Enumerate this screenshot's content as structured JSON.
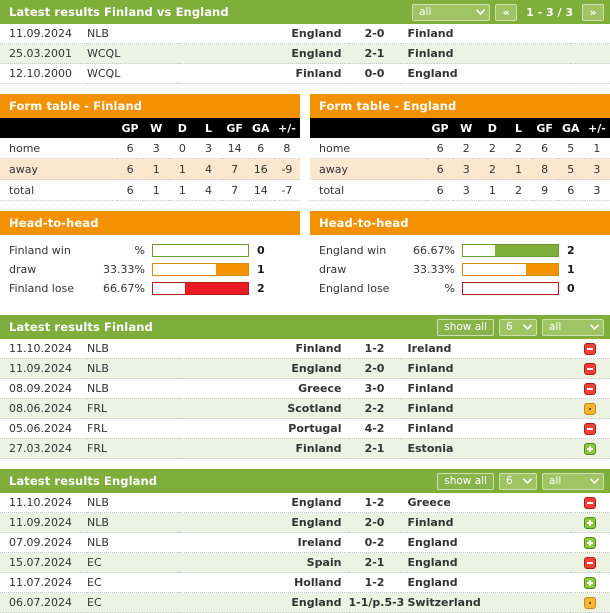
{
  "h2h_results": {
    "header": {
      "title": "Latest results Finland vs England",
      "filter_value": "all",
      "prev_label": "«",
      "next_label": "»",
      "page_label": "1 - 3 / 3"
    },
    "rows": [
      {
        "date": "11.09.2024",
        "comp": "NLB",
        "home": "England",
        "score": "2-0",
        "away": "Finland"
      },
      {
        "date": "25.03.2001",
        "comp": "WCQL",
        "home": "England",
        "score": "2-1",
        "away": "Finland"
      },
      {
        "date": "12.10.2000",
        "comp": "WCQL",
        "home": "Finland",
        "score": "0-0",
        "away": "England"
      }
    ]
  },
  "form_tables": [
    {
      "title": "Form table - Finland",
      "columns": [
        "",
        "GP",
        "W",
        "D",
        "L",
        "GF",
        "GA",
        "+/-"
      ],
      "rows": [
        {
          "label": "home",
          "gp": "6",
          "w": "3",
          "d": "0",
          "l": "3",
          "gf": "14",
          "ga": "6",
          "gd": "8"
        },
        {
          "label": "away",
          "gp": "6",
          "w": "1",
          "d": "1",
          "l": "4",
          "gf": "7",
          "ga": "16",
          "gd": "-9"
        },
        {
          "label": "total",
          "gp": "6",
          "w": "1",
          "d": "1",
          "l": "4",
          "gf": "7",
          "ga": "14",
          "gd": "-7"
        }
      ]
    },
    {
      "title": "Form table - England",
      "columns": [
        "",
        "GP",
        "W",
        "D",
        "L",
        "GF",
        "GA",
        "+/-"
      ],
      "rows": [
        {
          "label": "home",
          "gp": "6",
          "w": "2",
          "d": "2",
          "l": "2",
          "gf": "6",
          "ga": "5",
          "gd": "1"
        },
        {
          "label": "away",
          "gp": "6",
          "w": "3",
          "d": "2",
          "l": "1",
          "gf": "8",
          "ga": "5",
          "gd": "3"
        },
        {
          "label": "total",
          "gp": "6",
          "w": "3",
          "d": "1",
          "l": "2",
          "gf": "9",
          "ga": "6",
          "gd": "3"
        }
      ]
    }
  ],
  "head_to_head": [
    {
      "title": "Head-to-head",
      "rows": [
        {
          "label": "Finland win",
          "pct": "%",
          "fill": 0,
          "count": "0",
          "kind": "win"
        },
        {
          "label": "draw",
          "pct": "33.33%",
          "fill": 33.33,
          "count": "1",
          "kind": "draw"
        },
        {
          "label": "Finland lose",
          "pct": "66.67%",
          "fill": 66.67,
          "count": "2",
          "kind": "lose"
        }
      ]
    },
    {
      "title": "Head-to-head",
      "rows": [
        {
          "label": "England win",
          "pct": "66.67%",
          "fill": 66.67,
          "count": "2",
          "kind": "win"
        },
        {
          "label": "draw",
          "pct": "33.33%",
          "fill": 33.33,
          "count": "1",
          "kind": "draw"
        },
        {
          "label": "England lose",
          "pct": "%",
          "fill": 0,
          "count": "0",
          "kind": "lose"
        }
      ]
    }
  ],
  "latest_finland": {
    "header": {
      "title": "Latest results Finland",
      "show_all_label": "show all",
      "count_value": "6",
      "filter_value": "all"
    },
    "rows": [
      {
        "date": "11.10.2024",
        "comp": "NLB",
        "home": "Finland",
        "score": "1-2",
        "away": "Ireland",
        "status": "loss"
      },
      {
        "date": "11.09.2024",
        "comp": "NLB",
        "home": "England",
        "score": "2-0",
        "away": "Finland",
        "status": "loss"
      },
      {
        "date": "08.09.2024",
        "comp": "NLB",
        "home": "Greece",
        "score": "3-0",
        "away": "Finland",
        "status": "loss"
      },
      {
        "date": "08.06.2024",
        "comp": "FRL",
        "home": "Scotland",
        "score": "2-2",
        "away": "Finland",
        "status": "draw"
      },
      {
        "date": "05.06.2024",
        "comp": "FRL",
        "home": "Portugal",
        "score": "4-2",
        "away": "Finland",
        "status": "loss"
      },
      {
        "date": "27.03.2024",
        "comp": "FRL",
        "home": "Finland",
        "score": "2-1",
        "away": "Estonia",
        "status": "win"
      }
    ]
  },
  "latest_england": {
    "header": {
      "title": "Latest results England",
      "show_all_label": "show all",
      "count_value": "6",
      "filter_value": "all"
    },
    "rows": [
      {
        "date": "11.10.2024",
        "comp": "NLB",
        "home": "England",
        "score": "1-2",
        "away": "Greece",
        "status": "loss"
      },
      {
        "date": "11.09.2024",
        "comp": "NLB",
        "home": "England",
        "score": "2-0",
        "away": "Finland",
        "status": "win"
      },
      {
        "date": "07.09.2024",
        "comp": "NLB",
        "home": "Ireland",
        "score": "0-2",
        "away": "England",
        "status": "win"
      },
      {
        "date": "15.07.2024",
        "comp": "EC",
        "home": "Spain",
        "score": "2-1",
        "away": "England",
        "status": "loss"
      },
      {
        "date": "11.07.2024",
        "comp": "EC",
        "home": "Holland",
        "score": "1-2",
        "away": "England",
        "status": "win"
      },
      {
        "date": "06.07.2024",
        "comp": "EC",
        "home": "England",
        "score": "1-1/p.5-3",
        "away": "Switzerland",
        "status": "draw"
      }
    ]
  }
}
